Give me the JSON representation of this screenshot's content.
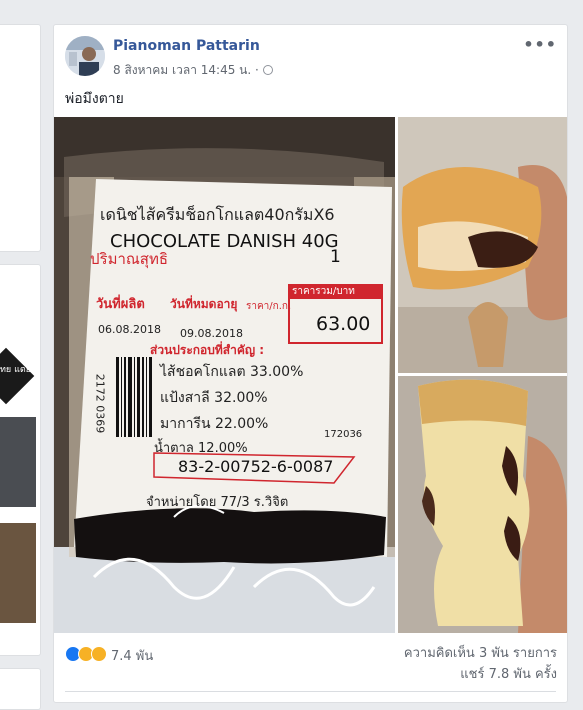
{
  "post": {
    "author": "Pianoman Pattarin",
    "timestamp": "8 สิงหาคม เวลา 14:45 น. ·",
    "caption": "พ่อมึงตาย",
    "more_icon": "more-options-icon",
    "privacy_icon": "globe-icon"
  },
  "label": {
    "line1": "เดนิชไส้ครีมช็อกโกแลต40กรัมX6",
    "line2": "CHOCOLATE DANISH 40G",
    "qty_label": "ปริมาณสุทธิ",
    "qty_value": "1",
    "mfg_label": "วันที่ผลิต",
    "exp_label": "วันที่หมดอายุ",
    "unit_price_label": "ราคา/ก.ก.",
    "price_header": "ราคารวม/บาท",
    "price": "63.00",
    "mfg_date": "06.08.2018",
    "exp_date": "09.08.2018",
    "ingredients_title": "ส่วนประกอบที่สำคัญ :",
    "ing1": "ไส้ชอคโกแลต 33.00%",
    "ing2": "แป้งสาลี 32.00%",
    "ing3": "มาการีน 22.00%",
    "ing4": "น้ำตาล 12.00%",
    "code": "83-2-00752-6-0087",
    "lot": "172036",
    "distributor": "จำหน่ายโดย 77/3 ร.วิจิต",
    "barcode_num": "2172 0369"
  },
  "left": {
    "diamond_text": "ทย แตย"
  },
  "footer": {
    "reaction_count": "7.4 พัน",
    "comments": "ความคิดเห็น 3 พัน รายการ",
    "shares": "แชร์ 7.8 พัน ครั้ง"
  },
  "colors": {
    "link": "#365899",
    "meta": "#616770",
    "label_red": "#d0262e",
    "like_blue": "#1877f2"
  }
}
